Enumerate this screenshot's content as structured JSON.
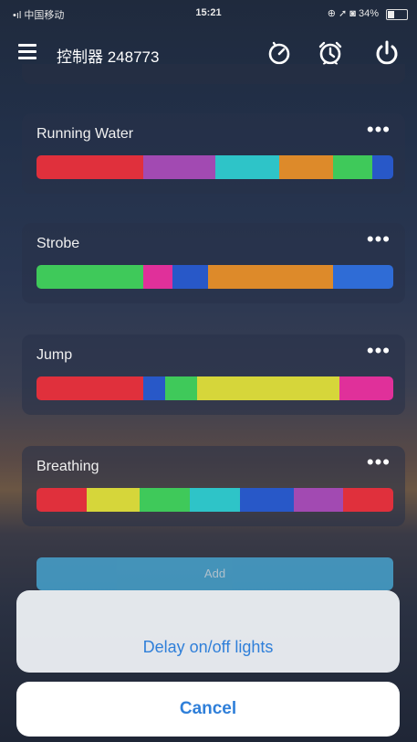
{
  "status_bar": {
    "carrier": "•ıl 中国移动 ",
    "time": "15:21",
    "indicators": "⊕ ➚ ◙ 34%"
  },
  "header": {
    "title": "控制器 248773",
    "icons": [
      "menu-icon",
      "timer-icon",
      "alarm-clock-icon",
      "power-icon"
    ]
  },
  "modes": [
    {
      "name": "Running Water",
      "more": "•••",
      "segments": [
        {
          "color": "#e0303c",
          "weight": 30
        },
        {
          "color": "#a24ab2",
          "weight": 20
        },
        {
          "color": "#2ec4c8",
          "weight": 18
        },
        {
          "color": "#dd8a2a",
          "weight": 15
        },
        {
          "color": "#3fc95a",
          "weight": 11
        },
        {
          "color": "#2858c8",
          "weight": 6
        }
      ]
    },
    {
      "name": "Strobe",
      "more": "•••",
      "segments": [
        {
          "color": "#3fc95a",
          "weight": 30
        },
        {
          "color": "#e0309a",
          "weight": 8
        },
        {
          "color": "#2858c8",
          "weight": 10
        },
        {
          "color": "#dd8a2a",
          "weight": 35
        },
        {
          "color": "#2f6cd6",
          "weight": 17
        }
      ]
    },
    {
      "name": "Jump",
      "more": "•••",
      "segments": [
        {
          "color": "#e0303c",
          "weight": 30
        },
        {
          "color": "#2858c8",
          "weight": 6
        },
        {
          "color": "#3fc95a",
          "weight": 9
        },
        {
          "color": "#d6d63a",
          "weight": 40
        },
        {
          "color": "#e0309a",
          "weight": 15
        }
      ]
    },
    {
      "name": "Breathing",
      "more": "•••",
      "segments": [
        {
          "color": "#e0303c",
          "weight": 14
        },
        {
          "color": "#d6d63a",
          "weight": 15
        },
        {
          "color": "#3fc95a",
          "weight": 14
        },
        {
          "color": "#2ec4c8",
          "weight": 14
        },
        {
          "color": "#2858c8",
          "weight": 15
        },
        {
          "color": "#a24ab2",
          "weight": 14
        },
        {
          "color": "#e0303c",
          "weight": 14
        }
      ]
    }
  ],
  "add_button": "Add",
  "action_sheet": {
    "action": "Delay on/off lights",
    "cancel": "Cancel"
  }
}
